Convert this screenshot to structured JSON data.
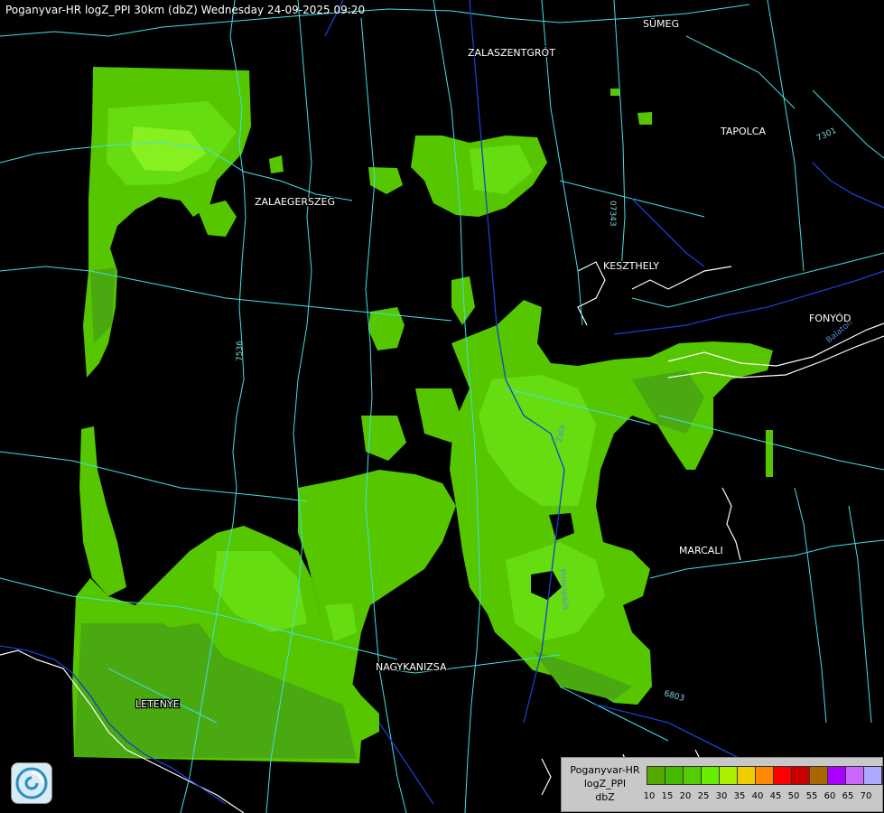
{
  "title": "Poganyvar-HR logZ_PPI 30km (dbZ) Wednesday 24-09-2025 09:20",
  "colors": {
    "background": "#000000",
    "road": "#40e0e8",
    "river": "#1a3fd0",
    "border": "#ffffff",
    "precip_main": "#55c600",
    "precip_dark": "#4aa810",
    "precip_light": "#66dd10",
    "precip_bright": "#88f020"
  },
  "places": [
    {
      "name": "SÜMEG",
      "id": "sumeg"
    },
    {
      "name": "ZALASZENTGRÓT",
      "id": "zalaszentgrot"
    },
    {
      "name": "TAPOLCA",
      "id": "tapolca"
    },
    {
      "name": "ZALAEGERSZEG",
      "id": "zalaegerszeg"
    },
    {
      "name": "KESZTHELY",
      "id": "keszthely"
    },
    {
      "name": "FONYÓD",
      "id": "fonyod"
    },
    {
      "name": "MARCALI",
      "id": "marcali"
    },
    {
      "name": "NAGYKANIZSA",
      "id": "nagykanizsa"
    },
    {
      "name": "LETENYE",
      "id": "letenye"
    }
  ],
  "road_labels": [
    "07343",
    "7301",
    "7536",
    "6803"
  ],
  "river_labels": [
    "Zala",
    "Balaton",
    "Principális"
  ],
  "legend": {
    "line1": "Poganyvar-HR",
    "line2": "logZ_PPI",
    "line3": "dbZ",
    "colors": [
      "#55aa00",
      "#44bb00",
      "#55cc00",
      "#66ee00",
      "#aaee00",
      "#eecc00",
      "#ff8800",
      "#ff0000",
      "#cc0000",
      "#aa6600",
      "#aa00ff",
      "#cc66ff",
      "#aaaaff"
    ],
    "ticks": [
      "10",
      "15",
      "20",
      "25",
      "30",
      "35",
      "40",
      "45",
      "50",
      "55",
      "60",
      "65",
      "70"
    ]
  },
  "logo_icon": "radar-swirl-logo"
}
